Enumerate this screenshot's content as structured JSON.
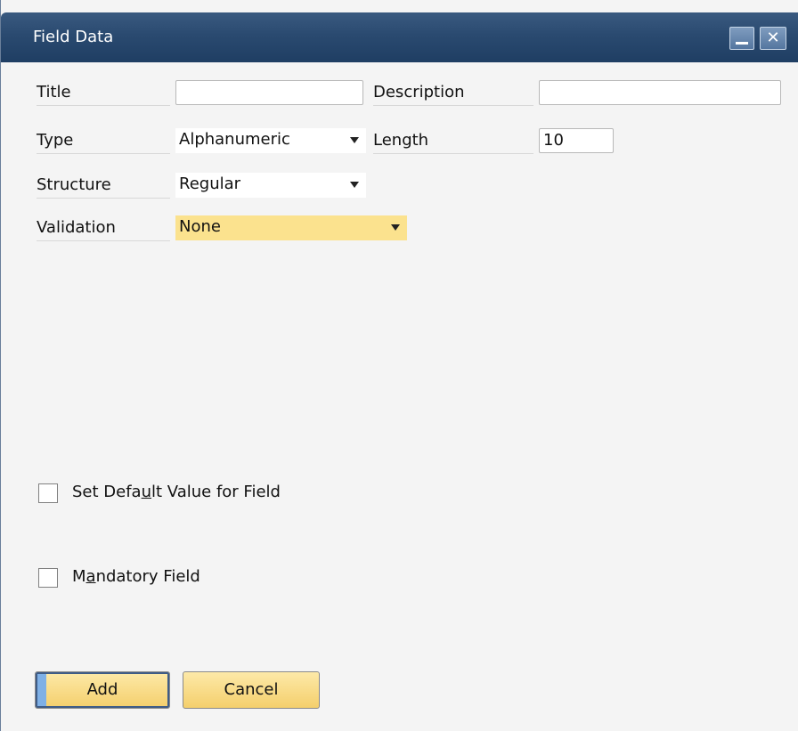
{
  "window": {
    "title": "Field Data"
  },
  "form": {
    "title_label": "Title",
    "title_value": "",
    "description_label": "Description",
    "description_value": "",
    "type_label": "Type",
    "type_value": "Alphanumeric",
    "length_label": "Length",
    "length_value": "10",
    "structure_label": "Structure",
    "structure_value": "Regular",
    "validation_label": "Validation",
    "validation_value": "None"
  },
  "options": {
    "default_value_prefix": "Set Defa",
    "default_value_underline": "u",
    "default_value_suffix": "lt Value for Field",
    "default_value_checked": false,
    "mandatory_prefix": "M",
    "mandatory_underline": "a",
    "mandatory_suffix": "ndatory Field",
    "mandatory_checked": false
  },
  "buttons": {
    "add": "Add",
    "cancel": "Cancel"
  },
  "icons": {
    "minimize": "minimize-icon",
    "close": "close-icon",
    "dropdown": "dropdown-arrow-icon"
  },
  "colors": {
    "title_bar": "#2a4a70",
    "highlight": "#fbe28e",
    "button": "#f4cf6c"
  }
}
